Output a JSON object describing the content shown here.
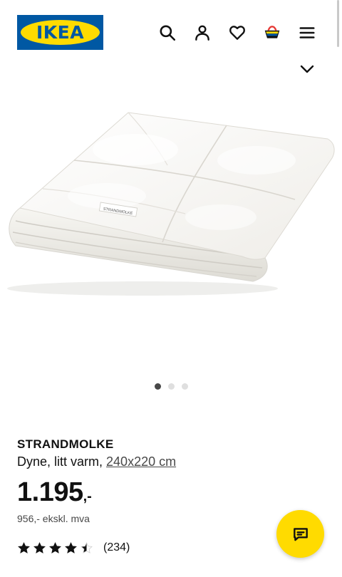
{
  "header": {
    "logo_text": "IKEA",
    "icons": [
      "search-icon",
      "user-icon",
      "heart-icon",
      "cart-icon",
      "menu-icon"
    ]
  },
  "colors": {
    "brand_blue": "#0058a3",
    "brand_yellow": "#ffdb00",
    "text": "#111111",
    "muted": "#484848"
  },
  "gallery": {
    "slide_count": 3,
    "active_slide": 1,
    "image_label": "STRANDMOLKE"
  },
  "product": {
    "name": "STRANDMOLKE",
    "description": "Dyne, litt varm, ",
    "size": "240x220 cm",
    "price": "1.195",
    "price_suffix": ",-",
    "price_ex_vat": "956,- ekskl. mva",
    "rating": 4.5,
    "rating_max": 5,
    "review_count": "(234)"
  },
  "chat": {
    "icon": "chat-icon"
  }
}
